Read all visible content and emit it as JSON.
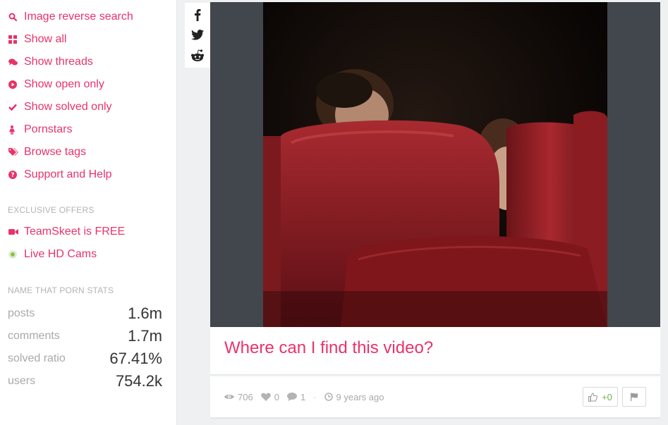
{
  "sidebar": {
    "nav": [
      {
        "label": "Image reverse search",
        "icon": "search-icon"
      },
      {
        "label": "Show all",
        "icon": "grid-icon"
      },
      {
        "label": "Show threads",
        "icon": "comments-icon"
      },
      {
        "label": "Show open only",
        "icon": "play-circle-icon"
      },
      {
        "label": "Show solved only",
        "icon": "check-icon"
      },
      {
        "label": "Pornstars",
        "icon": "female-icon"
      },
      {
        "label": "Browse tags",
        "icon": "tags-icon"
      },
      {
        "label": "Support and Help",
        "icon": "question-circle-icon"
      }
    ],
    "offers_title": "EXCLUSIVE OFFERS",
    "offers": [
      {
        "label": "TeamSkeet is FREE",
        "icon": "video-camera-icon"
      },
      {
        "label": "Live HD Cams",
        "icon": "live-dot-icon"
      }
    ],
    "stats_title": "NAME THAT PORN STATS",
    "stats": [
      {
        "label": "posts",
        "value": "1.6m"
      },
      {
        "label": "comments",
        "value": "1.7m"
      },
      {
        "label": "solved ratio",
        "value": "67.41%"
      },
      {
        "label": "users",
        "value": "754.2k"
      }
    ]
  },
  "share": [
    "facebook-icon",
    "twitter-icon",
    "reddit-icon"
  ],
  "post": {
    "title": "Where can I find this video?",
    "views": "706",
    "likes": "0",
    "comments": "1",
    "separator": "·",
    "time": "9 years ago",
    "score": "+0"
  },
  "colors": {
    "accent": "#e8336a",
    "positive": "#6bb54a",
    "live": "#8bc34a",
    "media_bg": "#42474d"
  }
}
